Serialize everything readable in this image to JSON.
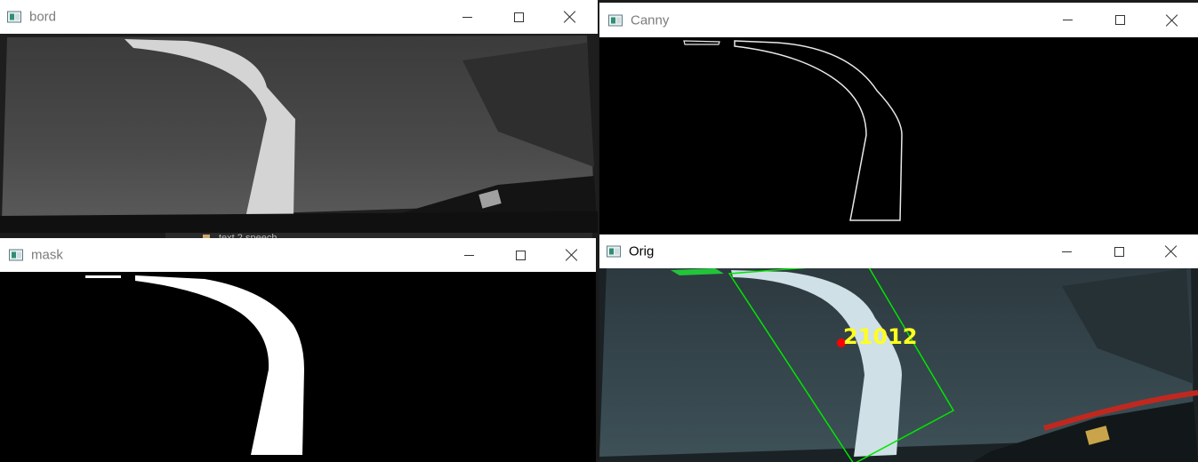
{
  "windows": {
    "bord": {
      "title": "bord"
    },
    "canny": {
      "title": "Canny"
    },
    "mask": {
      "title": "mask"
    },
    "orig": {
      "title": "Orig",
      "overlay_value": "21012"
    }
  },
  "background_window": {
    "label": "text 2 speech"
  },
  "colors": {
    "overlay_text": "#ffff1e",
    "overlay_box": "#00e600",
    "overlay_point": "#ff0000",
    "titlebar_bg": "#ffffff",
    "inactive_title": "#7b7b7b"
  },
  "icons": [
    "opencv-window-icon",
    "minimize-icon",
    "maximize-icon",
    "close-icon"
  ]
}
